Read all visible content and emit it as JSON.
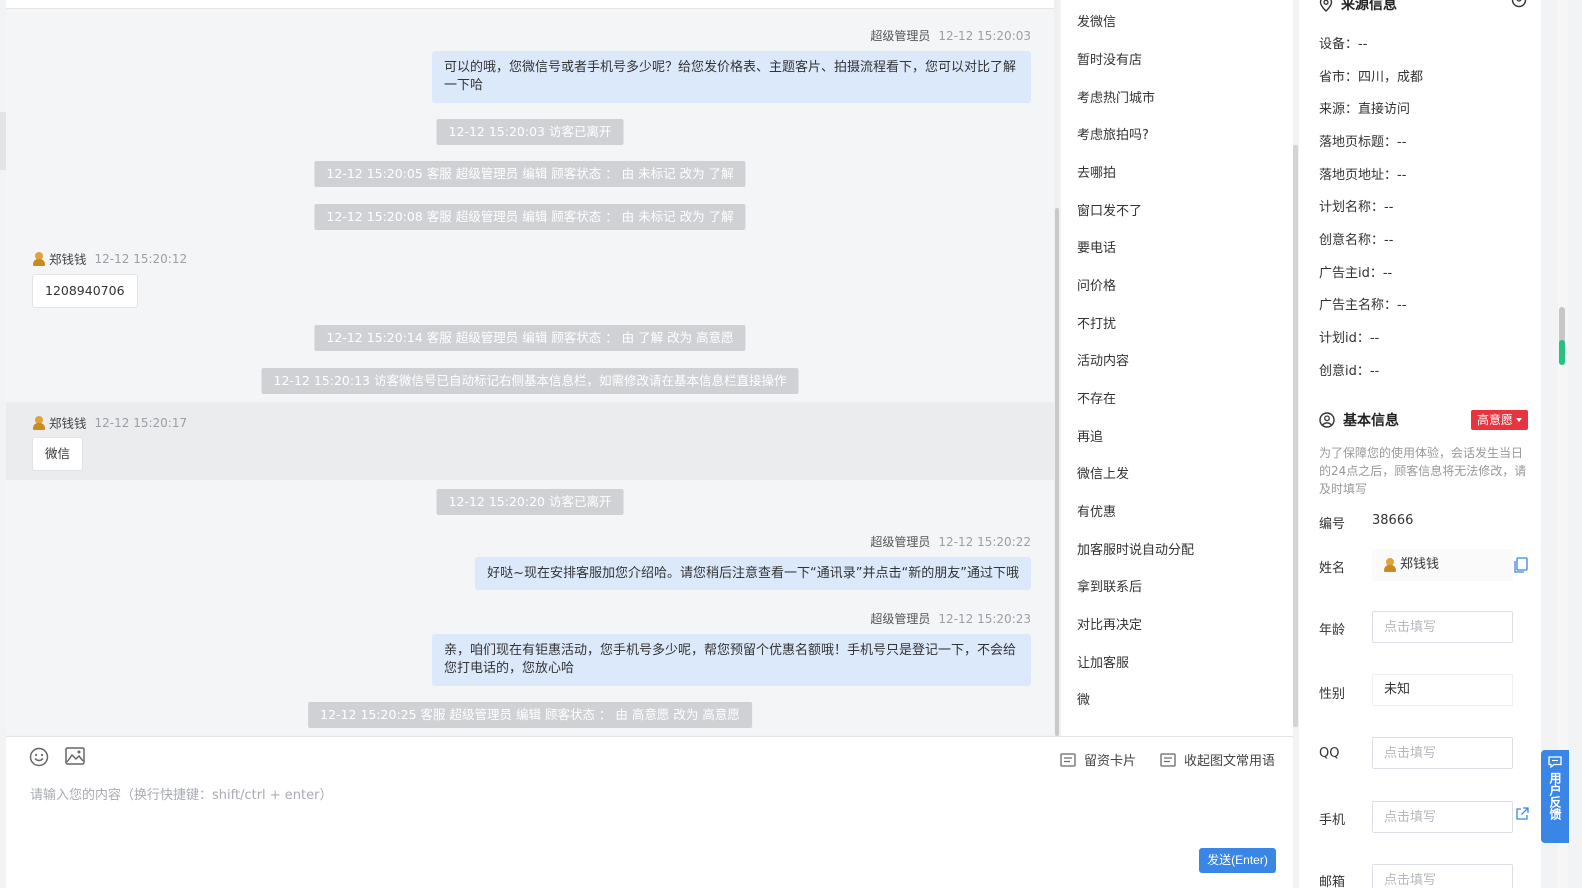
{
  "chat": {
    "messages": [
      {
        "sender": "超级管理员",
        "time": "12-12 15:20:03",
        "text_line1": "可以的哦，您微信号或者手机号多少呢？给您发价格表、主题客片、拍摄流程看下，您可以对比了解",
        "text_line2": "一下哈"
      },
      {
        "sender": "超级管理员",
        "time": "12-12 15:20:22",
        "text": "好哒~现在安排客服加您介绍哈。请您稍后注意查看一下“通讯录”并点击“新的朋友”通过下哦"
      },
      {
        "sender": "超级管理员",
        "time": "12-12 15:20:23",
        "text_line1": "亲，咱们现在有钜惠活动，您手机号多少呢，帮您预留个优惠名额哦！手机号只是登记一下，不会给",
        "text_line2": "您打电话的，您放心哈"
      }
    ],
    "notices": [
      "12-12 15:20:03 访客已离开",
      "12-12 15:20:05 客服 超级管理员 编辑 顾客状态 ： 由 未标记 改为 了解",
      "12-12 15:20:08 客服 超级管理员 编辑 顾客状态 ： 由 未标记 改为 了解",
      "12-12 15:20:14 客服 超级管理员 编辑 顾客状态 ： 由 了解 改为 高意愿",
      "12-12 15:20:13 访客微信号已自动标记右侧基本信息栏，如需修改请在基本信息栏直接操作",
      "12-12 15:20:20 访客已离开",
      "12-12 15:20:25 客服 超级管理员 编辑 顾客状态 ： 由 高意愿 改为 高意愿"
    ],
    "visitor_messages": [
      {
        "name": "郑钱钱",
        "time": "12-12 15:20:12",
        "text": "1208940706"
      },
      {
        "name": "郑钱钱",
        "time": "12-12 15:20:17",
        "text": "微信"
      }
    ]
  },
  "input": {
    "placeholder": "请输入您的内容（换行快捷键：shift/ctrl + enter）",
    "card_button": "留资卡片",
    "phrases_button": "收起图文常用语",
    "send_button": "发送(Enter)"
  },
  "quick_replies": [
    "发微信",
    "暂时没有店",
    "考虑热门城市",
    "考虑旅拍吗?",
    "去哪拍",
    "窗口发不了",
    "要电话",
    "问价格",
    "不打扰",
    "活动内容",
    "不存在",
    "再追",
    "微信上发",
    "有优惠",
    "加客服时说自动分配",
    "拿到联系后",
    "对比再决定",
    "让加客服",
    "微"
  ],
  "source_info": {
    "title": "来源信息",
    "rows": [
      "设备：--",
      "省市：四川，成都",
      "来源：直接访问",
      "落地页标题：--",
      "落地页地址：--",
      "计划名称：--",
      "创意名称：--",
      "广告主id：--",
      "广告主名称：--",
      "计划id：--",
      "创意id：--"
    ]
  },
  "basic_info": {
    "title": "基本信息",
    "intent_badge": "高意愿",
    "notice": "为了保障您的使用体验，会话发生当日的24点之后，顾客信息将无法修改，请及时填写",
    "id_label": "编号",
    "id_value": "38666",
    "name_label": "姓名",
    "name_value": "郑钱钱",
    "age_label": "年龄",
    "gender_label": "性别",
    "gender_value": "未知",
    "qq_label": "QQ",
    "phone_label": "手机",
    "email_label": "邮箱",
    "field_placeholder": "点击填写"
  },
  "feedback_tab": "用户反馈",
  "colors": {
    "accent": "#3a86e6",
    "badge_red": "#e8343f",
    "agent_bubble": "#dce9fb",
    "notice_bg": "#cfd1d4"
  }
}
